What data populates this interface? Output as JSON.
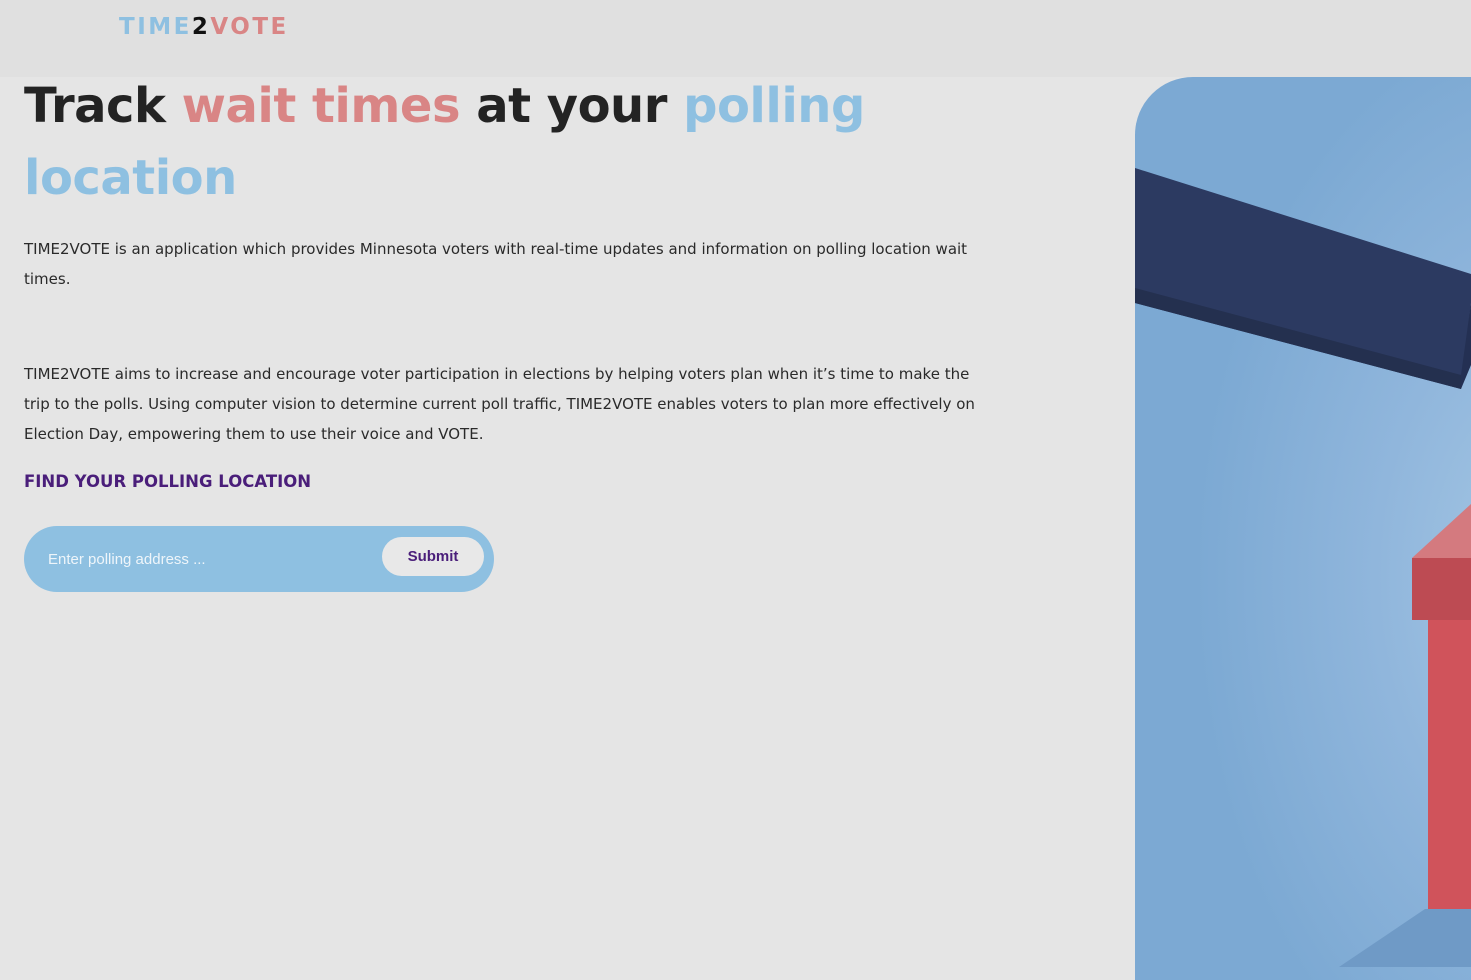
{
  "header": {
    "logo": {
      "part1": "TIME",
      "part2": "2",
      "part3": "VOTE"
    }
  },
  "hero": {
    "headline": {
      "part1": "Track ",
      "part2": "wait times",
      "part3": " at your ",
      "part4": "polling location"
    },
    "paragraph1": "TIME2VOTE is an application which provides Minnesota voters with real-time updates and information on polling location wait times.",
    "paragraph2": "TIME2VOTE aims to increase and encourage voter participation in elections by helping voters plan when it’s time to make the trip to the polls. Using computer vision to determine current poll traffic, TIME2VOTE enables voters to plan more effectively on Election Day, empowering them to use their voice and VOTE."
  },
  "search": {
    "heading": "FIND YOUR POLLING LOCATION",
    "placeholder": "Enter polling address ...",
    "value": "",
    "submit_label": "Submit"
  },
  "colors": {
    "background": "#e5e5e5",
    "header_background": "#e0e0e0",
    "accent_blue": "#8ec0e1",
    "accent_red": "#d98585",
    "purple": "#4a1e7a",
    "text_dark": "#232323",
    "illustration_navy": "#2c3a61",
    "illustration_red": "#d0535b"
  },
  "icons": {
    "illustration": "ballot-box-illustration"
  }
}
